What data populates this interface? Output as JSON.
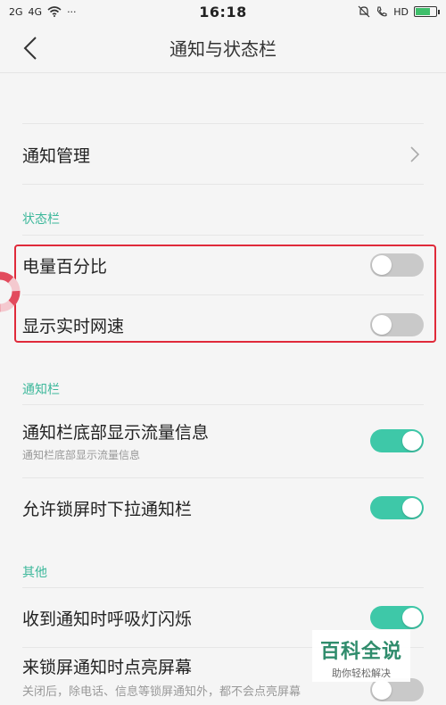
{
  "status_bar": {
    "signal1": "2G",
    "signal2": "4G",
    "dots": "···",
    "time": "16:18",
    "hd": "HD"
  },
  "header": {
    "title": "通知与状态栏"
  },
  "rows": {
    "notification_management": "通知管理",
    "battery_percentage": "电量百分比",
    "realtime_speed": "显示实时网速",
    "bottom_traffic": "通知栏底部显示流量信息",
    "bottom_traffic_sub": "通知栏底部显示流量信息",
    "lockscreen_pulldown": "允许锁屏时下拉通知栏",
    "breathing_light": "收到通知时呼吸灯闪烁",
    "wake_screen": "来锁屏通知时点亮屏幕",
    "wake_screen_sub": "关闭后，除电话、信息等锁屏通知外，都不会点亮屏幕"
  },
  "sections": {
    "status_bar": "状态栏",
    "notification_bar": "通知栏",
    "other": "其他"
  },
  "toggles": {
    "battery_percentage": false,
    "realtime_speed": false,
    "bottom_traffic": true,
    "lockscreen_pulldown": true,
    "breathing_light": true,
    "wake_screen": false
  },
  "watermark": {
    "title": "百科全说",
    "subtitle": "助你轻松解决"
  },
  "colors": {
    "accent": "#3ec8a8",
    "section_label": "#3db89b",
    "highlight": "#e02a3a",
    "toggle_off": "#c9c9c9"
  }
}
